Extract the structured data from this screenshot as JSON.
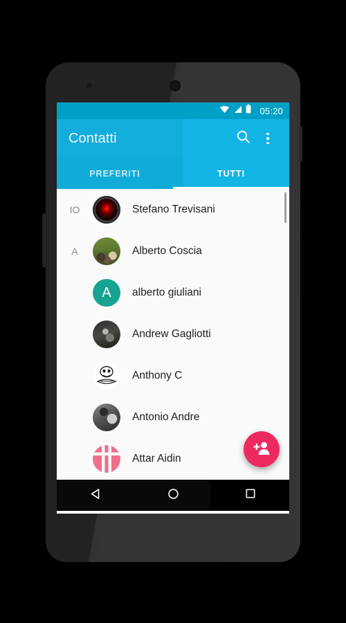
{
  "status_bar": {
    "time": "05:20",
    "icons": [
      "wifi-icon",
      "signal-icon",
      "battery-icon"
    ]
  },
  "app_bar": {
    "title": "Contatti",
    "search_icon": "search-icon",
    "overflow_icon": "overflow-menu-icon"
  },
  "tabs": [
    {
      "label": "PREFERITI",
      "active": false
    },
    {
      "label": "TUTTI",
      "active": true
    }
  ],
  "contacts": [
    {
      "section": "IO",
      "name": "Stefano Trevisani",
      "avatar_style": "av-hal",
      "avatar_letter": ""
    },
    {
      "section": "A",
      "name": "Alberto Coscia",
      "avatar_style": "av-photo-family",
      "avatar_letter": ""
    },
    {
      "section": "",
      "name": "alberto giuliani",
      "avatar_style": "av-letter",
      "avatar_letter": "A"
    },
    {
      "section": "",
      "name": "Andrew Gagliotti",
      "avatar_style": "av-photo-dark",
      "avatar_letter": ""
    },
    {
      "section": "",
      "name": "Anthony C",
      "avatar_style": "av-meme",
      "avatar_letter": ""
    },
    {
      "section": "",
      "name": "Antonio Andre",
      "avatar_style": "av-photo-bw",
      "avatar_letter": ""
    },
    {
      "section": "",
      "name": "Attar Aidin",
      "avatar_style": "av-check",
      "avatar_letter": ""
    }
  ],
  "fab": {
    "icon": "add-person-icon",
    "color": "#ec2a5f"
  },
  "nav_bar": {
    "back": "back-icon",
    "home": "home-icon",
    "recents": "recents-icon"
  },
  "colors": {
    "app_bar": "#13b5e5",
    "status_bar": "#00a0c6",
    "accent": "#ec2a5f",
    "letter_avatar": "#17a391",
    "list_background": "#fafafa"
  }
}
